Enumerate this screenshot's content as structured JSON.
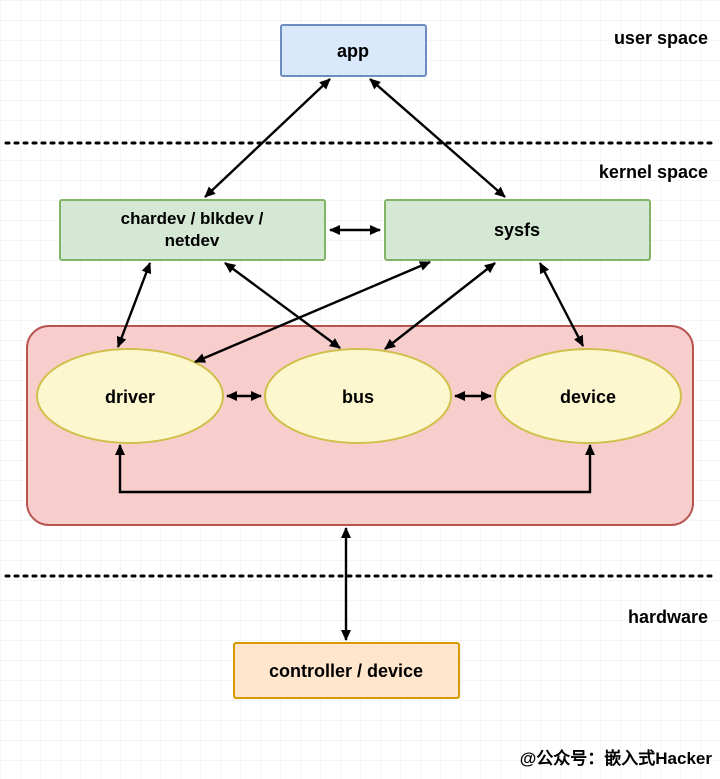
{
  "regions": {
    "user_space": "user space",
    "kernel_space": "kernel space",
    "hardware": "hardware"
  },
  "nodes": {
    "app": "app",
    "chardev": "chardev / blkdev /\nnetdev",
    "sysfs": "sysfs",
    "driver": "driver",
    "bus": "bus",
    "device": "device",
    "controller": "controller / device"
  },
  "credit": "@公众号：嵌入式Hacker",
  "colors": {
    "grid": "#ebebeb",
    "app_fill": "#dae8fc",
    "app_stroke": "#6c8ebf",
    "green_fill": "#d5e8d4",
    "green_stroke": "#82b366",
    "pink_fill": "#f8cecc",
    "pink_stroke": "#b85450",
    "yellow_fill": "#fdf7cf",
    "yellow_stroke": "#cfc04a",
    "orange_fill": "#ffe6cc",
    "orange_stroke": "#d79b00",
    "text": "#000000"
  },
  "chart_data": {
    "type": "diagram",
    "title": "Linux device-model layers",
    "regions": [
      {
        "name": "user space",
        "y_range": [
          0,
          143
        ]
      },
      {
        "name": "kernel space",
        "y_range": [
          143,
          576
        ]
      },
      {
        "name": "hardware",
        "y_range": [
          576,
          779
        ]
      }
    ],
    "nodes": [
      {
        "id": "app",
        "label": "app",
        "shape": "rect",
        "region": "user space"
      },
      {
        "id": "chardev",
        "label": "chardev / blkdev / netdev",
        "shape": "rect",
        "region": "kernel space"
      },
      {
        "id": "sysfs",
        "label": "sysfs",
        "shape": "rect",
        "region": "kernel space"
      },
      {
        "id": "driver",
        "label": "driver",
        "shape": "ellipse",
        "region": "kernel space",
        "group": "device-model"
      },
      {
        "id": "bus",
        "label": "bus",
        "shape": "ellipse",
        "region": "kernel space",
        "group": "device-model"
      },
      {
        "id": "device",
        "label": "device",
        "shape": "ellipse",
        "region": "kernel space",
        "group": "device-model"
      },
      {
        "id": "controller",
        "label": "controller / device",
        "shape": "rect",
        "region": "hardware"
      }
    ],
    "edges_bidirectional": [
      [
        "app",
        "chardev"
      ],
      [
        "app",
        "sysfs"
      ],
      [
        "chardev",
        "sysfs"
      ],
      [
        "chardev",
        "driver"
      ],
      [
        "chardev",
        "bus"
      ],
      [
        "sysfs",
        "driver"
      ],
      [
        "sysfs",
        "bus"
      ],
      [
        "sysfs",
        "device"
      ],
      [
        "driver",
        "bus"
      ],
      [
        "bus",
        "device"
      ],
      [
        "driver",
        "device"
      ],
      [
        "bus",
        "controller"
      ]
    ]
  }
}
